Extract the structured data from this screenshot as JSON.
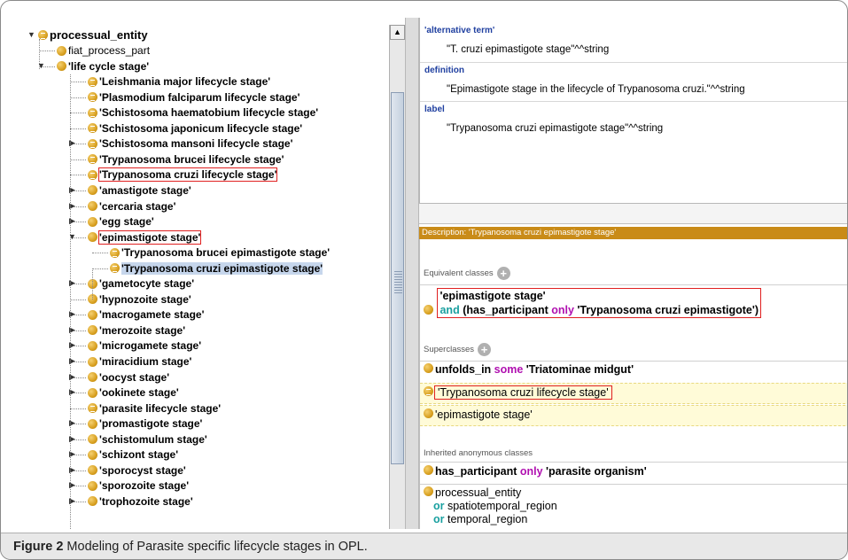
{
  "tree": {
    "root": "processual_entity",
    "items": [
      {
        "label": "fiat_process_part",
        "depth": 1,
        "icon": "class",
        "toggle": "none",
        "bold": false
      },
      {
        "label": "'life cycle stage'",
        "depth": 1,
        "icon": "class",
        "toggle": "open",
        "bold": true
      },
      {
        "label": "'Leishmania major lifecycle stage'",
        "depth": 2,
        "icon": "defined",
        "toggle": "none",
        "bold": true
      },
      {
        "label": "'Plasmodium falciparum lifecycle stage'",
        "depth": 2,
        "icon": "defined",
        "toggle": "none",
        "bold": true
      },
      {
        "label": "'Schistosoma haematobium lifecycle stage'",
        "depth": 2,
        "icon": "defined",
        "toggle": "none",
        "bold": true
      },
      {
        "label": "'Schistosoma japonicum lifecycle stage'",
        "depth": 2,
        "icon": "defined",
        "toggle": "none",
        "bold": true
      },
      {
        "label": "'Schistosoma mansoni lifecycle stage'",
        "depth": 2,
        "icon": "defined",
        "toggle": "closed",
        "bold": true
      },
      {
        "label": "'Trypanosoma brucei lifecycle stage'",
        "depth": 2,
        "icon": "defined",
        "toggle": "none",
        "bold": true
      },
      {
        "label": "'Trypanosoma cruzi lifecycle stage'",
        "depth": 2,
        "icon": "defined",
        "toggle": "none",
        "bold": true,
        "boxed": true
      },
      {
        "label": "'amastigote stage'",
        "depth": 2,
        "icon": "class",
        "toggle": "closed",
        "bold": true
      },
      {
        "label": "'cercaria stage'",
        "depth": 2,
        "icon": "class",
        "toggle": "closed",
        "bold": true
      },
      {
        "label": "'egg stage'",
        "depth": 2,
        "icon": "class",
        "toggle": "closed",
        "bold": true
      },
      {
        "label": "'epimastigote stage'",
        "depth": 2,
        "icon": "class",
        "toggle": "open",
        "bold": true,
        "boxed": true
      },
      {
        "label": "'Trypanosoma brucei epimastigote stage'",
        "depth": 3,
        "icon": "defined",
        "toggle": "none",
        "bold": true
      },
      {
        "label": "'Trypanosoma cruzi epimastigote stage'",
        "depth": 3,
        "icon": "defined",
        "toggle": "none",
        "bold": true,
        "selected": true
      },
      {
        "label": "'gametocyte stage'",
        "depth": 2,
        "icon": "class",
        "toggle": "closed",
        "bold": true
      },
      {
        "label": "'hypnozoite stage'",
        "depth": 2,
        "icon": "class",
        "toggle": "none",
        "bold": true
      },
      {
        "label": "'macrogamete stage'",
        "depth": 2,
        "icon": "class",
        "toggle": "closed",
        "bold": true
      },
      {
        "label": "'merozoite stage'",
        "depth": 2,
        "icon": "class",
        "toggle": "closed",
        "bold": true
      },
      {
        "label": "'microgamete stage'",
        "depth": 2,
        "icon": "class",
        "toggle": "closed",
        "bold": true
      },
      {
        "label": "'miracidium stage'",
        "depth": 2,
        "icon": "class",
        "toggle": "closed",
        "bold": true
      },
      {
        "label": "'oocyst stage'",
        "depth": 2,
        "icon": "class",
        "toggle": "closed",
        "bold": true
      },
      {
        "label": "'ookinete stage'",
        "depth": 2,
        "icon": "class",
        "toggle": "closed",
        "bold": true
      },
      {
        "label": "'parasite lifecycle stage'",
        "depth": 2,
        "icon": "defined",
        "toggle": "none",
        "bold": true
      },
      {
        "label": "'promastigote stage'",
        "depth": 2,
        "icon": "class",
        "toggle": "closed",
        "bold": true
      },
      {
        "label": "'schistomulum stage'",
        "depth": 2,
        "icon": "class",
        "toggle": "closed",
        "bold": true
      },
      {
        "label": "'schizont stage'",
        "depth": 2,
        "icon": "class",
        "toggle": "closed",
        "bold": true
      },
      {
        "label": "'sporocyst stage'",
        "depth": 2,
        "icon": "class",
        "toggle": "closed",
        "bold": true
      },
      {
        "label": "'sporozoite stage'",
        "depth": 2,
        "icon": "class",
        "toggle": "closed",
        "bold": true
      },
      {
        "label": "'trophozoite stage'",
        "depth": 2,
        "icon": "class",
        "toggle": "closed",
        "bold": true
      }
    ]
  },
  "annotations": [
    {
      "key": "'alternative term'",
      "value": "\"T. cruzi epimastigote stage\"^^string"
    },
    {
      "key": "definition",
      "value": "\"Epimastigote stage in the lifecycle of Trypanosoma cruzi.\"^^string"
    },
    {
      "key": "label",
      "value": "\"Trypanosoma cruzi epimastigote stage\"^^string"
    }
  ],
  "description": {
    "header": "Description: 'Trypanosoma cruzi epimastigote stage'",
    "equivalent_title": "Equivalent classes",
    "equivalent_line1": "'epimastigote stage'",
    "equivalent_line2": {
      "and": "and",
      "prop": " (has_participant ",
      "only": "only",
      "filler": " 'Trypanosoma cruzi epimastigote')"
    },
    "superclasses_title": "Superclasses",
    "super1": {
      "prop": "unfolds_in ",
      "some": "some",
      "filler": " 'Triatominae midgut'"
    },
    "super2": "'Trypanosoma cruzi lifecycle stage'",
    "super3": "'epimastigote stage'",
    "inherited_title": "Inherited anonymous classes",
    "inh1": {
      "prop": "has_participant ",
      "only": "only",
      "filler": " 'parasite organism'"
    },
    "inh2": {
      "line1": "processual_entity",
      "or1": "or",
      "l2": " spatiotemporal_region",
      "or2": "or",
      "l3": " temporal_region"
    }
  },
  "caption": {
    "figure": "Figure 2",
    "text": " Modeling of Parasite specific lifecycle stages in OPL."
  },
  "colors": {
    "accent_header": "#c98b18",
    "highlight_box": "#e02020",
    "selection": "#c6d6ec",
    "keyword_teal": "#1aa0a0",
    "keyword_magenta": "#b010b0"
  }
}
